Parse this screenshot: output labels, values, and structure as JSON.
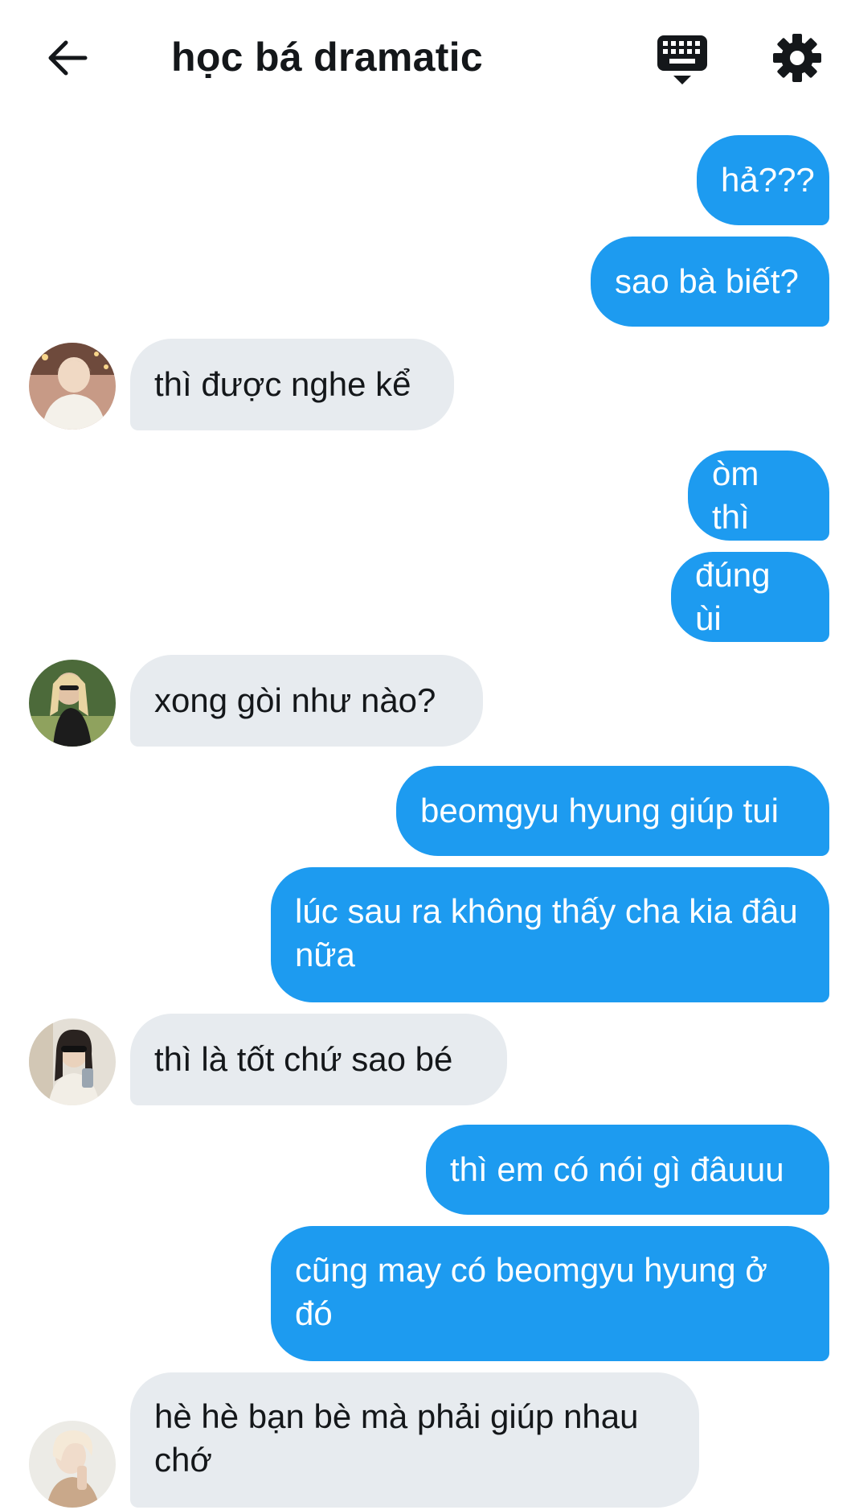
{
  "header": {
    "title": "học bá dramatic",
    "back_icon": "arrow-left-icon",
    "keyboard_icon": "keyboard-icon",
    "settings_icon": "gear-icon"
  },
  "colors": {
    "outgoing_bubble": "#1d9bf0",
    "incoming_bubble": "#e7ebef",
    "text": "#14171a"
  },
  "messages": [
    {
      "direction": "out",
      "text": "hả???"
    },
    {
      "direction": "out",
      "text": "sao bà biết?"
    },
    {
      "direction": "in",
      "text": "thì được nghe kể",
      "avatar": "avatar-1"
    },
    {
      "direction": "out",
      "text": "òm thì"
    },
    {
      "direction": "out",
      "text": "đúng ùi"
    },
    {
      "direction": "in",
      "text": "xong gòi như nào?",
      "avatar": "avatar-2"
    },
    {
      "direction": "out",
      "text": "beomgyu hyung giúp tui"
    },
    {
      "direction": "out",
      "text": "lúc sau ra không thấy cha kia đâu nữa"
    },
    {
      "direction": "in",
      "text": "thì là tốt chứ sao bé",
      "avatar": "avatar-3"
    },
    {
      "direction": "out",
      "text": "thì em có nói gì đâuuu"
    },
    {
      "direction": "out",
      "text": "cũng may có beomgyu hyung ở đó"
    },
    {
      "direction": "in",
      "text": "hè hè bạn bè mà phải giúp nhau chớ",
      "avatar": "avatar-4"
    }
  ]
}
